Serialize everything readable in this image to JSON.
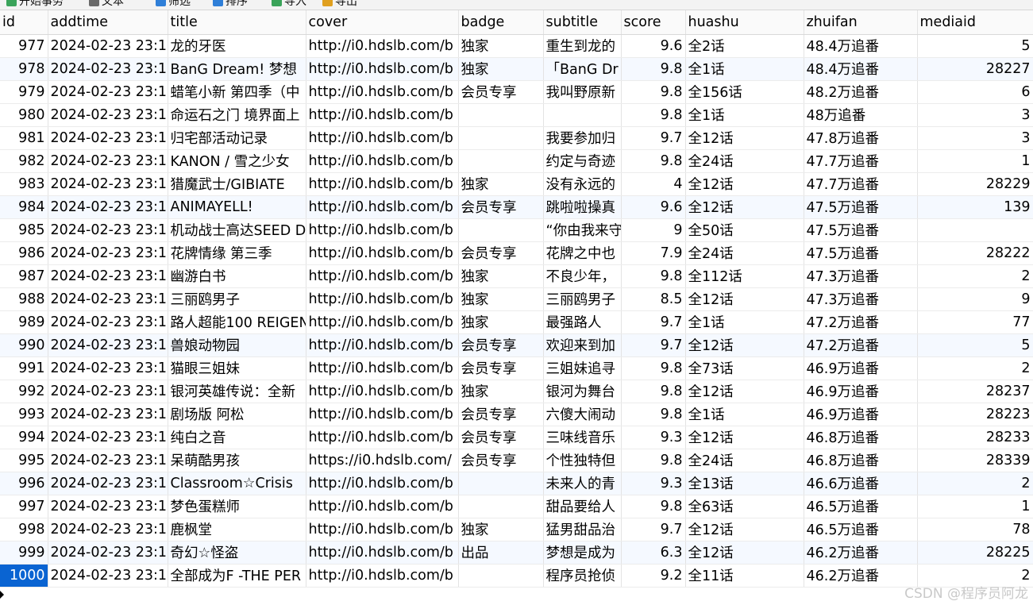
{
  "toolbar": {
    "items": [
      {
        "label": "开始事务",
        "icon": "begin-transaction-icon",
        "color": "#3aa35a"
      },
      {
        "label": "文本",
        "icon": "text-icon",
        "color": "#6a6a6a"
      },
      {
        "label": "筛选",
        "icon": "filter-icon",
        "color": "#2f7fd8"
      },
      {
        "label": "排序",
        "icon": "sort-icon",
        "color": "#2f7fd8"
      },
      {
        "label": "导入",
        "icon": "import-icon",
        "color": "#3aa35a"
      },
      {
        "label": "导出",
        "icon": "export-icon",
        "color": "#e0a020"
      }
    ]
  },
  "table": {
    "columns": [
      "id",
      "addtime",
      "title",
      "cover",
      "badge",
      "subtitle",
      "score",
      "huashu",
      "zhuifan",
      "mediaid"
    ],
    "rows": [
      [
        "977",
        "2024-02-23 23:1",
        "龙的牙医",
        "http://i0.hdslb.com/b",
        "独家",
        "重生到龙的",
        "9.6",
        "全2话",
        "48.4万追番",
        "5"
      ],
      [
        "978",
        "2024-02-23 23:1",
        "BanG Dream! 梦想",
        "http://i0.hdslb.com/b",
        "独家",
        "「BanG Dr",
        "9.8",
        "全1话",
        "48.4万追番",
        "28227"
      ],
      [
        "979",
        "2024-02-23 23:1",
        "蜡笔小新 第四季（中",
        "http://i0.hdslb.com/b",
        "会员专享",
        "我叫野原新",
        "9.8",
        "全156话",
        "48.2万追番",
        "6"
      ],
      [
        "980",
        "2024-02-23 23:1",
        "命运石之门 境界面上",
        "http://i0.hdslb.com/b",
        "",
        "",
        "9.8",
        "全1话",
        "48万追番",
        "3"
      ],
      [
        "981",
        "2024-02-23 23:1",
        "归宅部活动记录",
        "http://i0.hdslb.com/b",
        "",
        "我要参加归",
        "9.7",
        "全12话",
        "47.8万追番",
        "3"
      ],
      [
        "982",
        "2024-02-23 23:1",
        "KANON / 雪之少女",
        "http://i0.hdslb.com/b",
        "",
        "约定与奇迹",
        "9.8",
        "全24话",
        "47.7万追番",
        "1"
      ],
      [
        "983",
        "2024-02-23 23:1",
        "猎魔武士/GIBIATE",
        "http://i0.hdslb.com/b",
        "独家",
        "没有永远的",
        "4",
        "全12话",
        "47.7万追番",
        "28229"
      ],
      [
        "984",
        "2024-02-23 23:1",
        "ANIMAYELL!",
        "http://i0.hdslb.com/b",
        "会员专享",
        "跳啦啦操真",
        "9.6",
        "全12话",
        "47.5万追番",
        "139"
      ],
      [
        "985",
        "2024-02-23 23:1",
        "机动战士高达SEED D",
        "http://i0.hdslb.com/b",
        "",
        "“你由我来守",
        "9",
        "全50话",
        "47.5万追番",
        ""
      ],
      [
        "986",
        "2024-02-23 23:1",
        "花牌情缘 第三季",
        "http://i0.hdslb.com/b",
        "会员专享",
        "花牌之中也",
        "7.9",
        "全24话",
        "47.5万追番",
        "28222"
      ],
      [
        "987",
        "2024-02-23 23:1",
        "幽游白书",
        "http://i0.hdslb.com/b",
        "独家",
        "不良少年，",
        "9.8",
        "全112话",
        "47.3万追番",
        "2"
      ],
      [
        "988",
        "2024-02-23 23:1",
        "三丽鸥男子",
        "http://i0.hdslb.com/b",
        "独家",
        "三丽鸥男子",
        "8.5",
        "全12话",
        "47.3万追番",
        "9"
      ],
      [
        "989",
        "2024-02-23 23:1",
        "路人超能100 REIGEN",
        "http://i0.hdslb.com/b",
        "独家",
        "最强路人",
        "9.7",
        "全1话",
        "47.2万追番",
        "77"
      ],
      [
        "990",
        "2024-02-23 23:1",
        "兽娘动物园",
        "http://i0.hdslb.com/b",
        "会员专享",
        "欢迎来到加",
        "9.7",
        "全12话",
        "47.2万追番",
        "5"
      ],
      [
        "991",
        "2024-02-23 23:1",
        "猫眼三姐妹",
        "http://i0.hdslb.com/b",
        "会员专享",
        "三姐妹追寻",
        "9.8",
        "全73话",
        "46.9万追番",
        "2"
      ],
      [
        "992",
        "2024-02-23 23:1",
        "银河英雄传说：全新",
        "http://i0.hdslb.com/b",
        "独家",
        "银河为舞台",
        "9.8",
        "全12话",
        "46.9万追番",
        "28237"
      ],
      [
        "993",
        "2024-02-23 23:1",
        "剧场版 阿松",
        "http://i0.hdslb.com/b",
        "会员专享",
        "六傻大闹动",
        "9.8",
        "全1话",
        "46.9万追番",
        "28223"
      ],
      [
        "994",
        "2024-02-23 23:1",
        "纯白之音",
        "http://i0.hdslb.com/b",
        "会员专享",
        "三味线音乐",
        "9.3",
        "全12话",
        "46.8万追番",
        "28233"
      ],
      [
        "995",
        "2024-02-23 23:1",
        "呆萌酷男孩",
        "https://i0.hdslb.com/",
        "会员专享",
        "个性独特但",
        "9.8",
        "全24话",
        "46.8万追番",
        "28339"
      ],
      [
        "996",
        "2024-02-23 23:1",
        "Classroom☆Crisis",
        "http://i0.hdslb.com/b",
        "",
        "未来人的青",
        "9.3",
        "全13话",
        "46.6万追番",
        "2"
      ],
      [
        "997",
        "2024-02-23 23:1",
        "梦色蛋糕师",
        "http://i0.hdslb.com/b",
        "",
        "甜品要给人",
        "9.8",
        "全63话",
        "46.5万追番",
        "1"
      ],
      [
        "998",
        "2024-02-23 23:1",
        "鹿枫堂",
        "http://i0.hdslb.com/b",
        "独家",
        "猛男甜品治",
        "9.7",
        "全12话",
        "46.5万追番",
        "78"
      ],
      [
        "999",
        "2024-02-23 23:1",
        "奇幻☆怪盗",
        "http://i0.hdslb.com/b",
        "出品",
        "梦想是成为",
        "6.3",
        "全12话",
        "46.2万追番",
        "28225"
      ],
      [
        "1000",
        "2024-02-23 23:1",
        "全部成为F -THE PER",
        "http://i0.hdslb.com/b",
        "",
        "程序员抢侦",
        "9.2",
        "全11话",
        "46.2万追番",
        "2"
      ]
    ],
    "alt_rows": [
      1,
      7,
      13,
      19,
      22
    ],
    "selected_row": 23
  },
  "watermark": "CSDN @程序员阿龙",
  "colors": {
    "selected_cell_bg": "#0a64d2",
    "alt_row_bg": "#f5f9ff"
  }
}
